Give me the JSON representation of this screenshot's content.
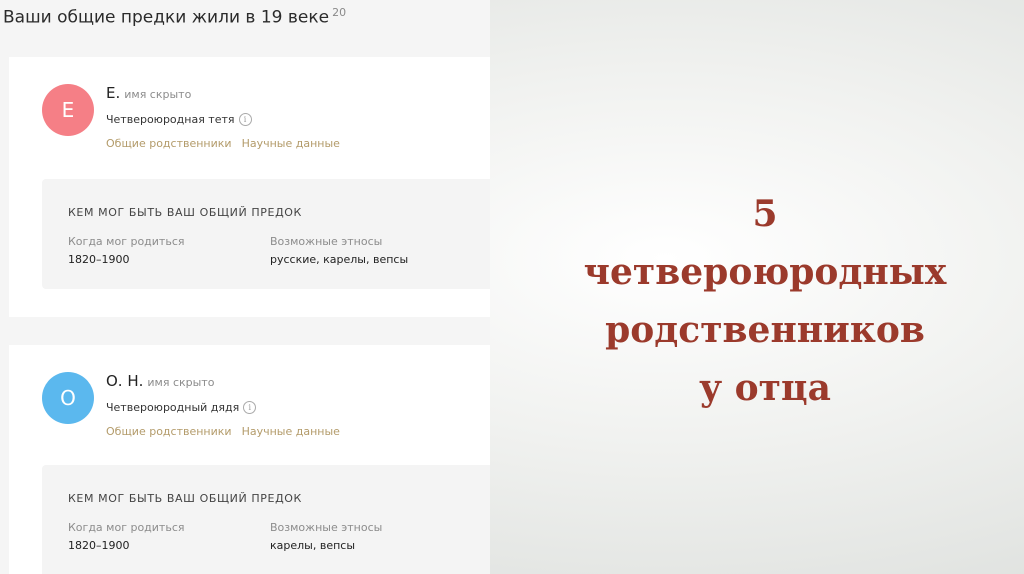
{
  "section": {
    "title": "Ваши общие предки жили в 19 веке",
    "count": "20"
  },
  "cards": [
    {
      "initial": "Е",
      "name": "Е.",
      "hidden_label": "имя скрыто",
      "relation": "Четвероюродная тетя",
      "link_relatives": "Общие родственники",
      "link_science": "Научные данные",
      "ancestor_title": "КЕМ МОГ БЫТЬ ВАШ ОБЩИЙ ПРЕДОК",
      "birth_label": "Когда мог родиться",
      "birth_value": "1820–1900",
      "ethnos_label": "Возможные этносы",
      "ethnos_value": "русские, карелы, вепсы"
    },
    {
      "initial": "О",
      "name": "О. Н.",
      "hidden_label": "имя скрыто",
      "relation": "Четвероюродный дядя",
      "link_relatives": "Общие родственники",
      "link_science": "Научные данные",
      "ancestor_title": "КЕМ МОГ БЫТЬ ВАШ ОБЩИЙ ПРЕДОК",
      "birth_label": "Когда мог родиться",
      "birth_value": "1820–1900",
      "ethnos_label": "Возможные этносы",
      "ethnos_value": "карелы, вепсы"
    }
  ],
  "headline": [
    "5",
    "четвероюродных",
    "родственников",
    "у отца"
  ],
  "colors": {
    "avatar_1": "#f57f86",
    "avatar_2": "#5bb8ee",
    "link": "#b39b6a",
    "headline": "#9b3a2c"
  },
  "icons": {
    "info": "info-circle-icon"
  }
}
